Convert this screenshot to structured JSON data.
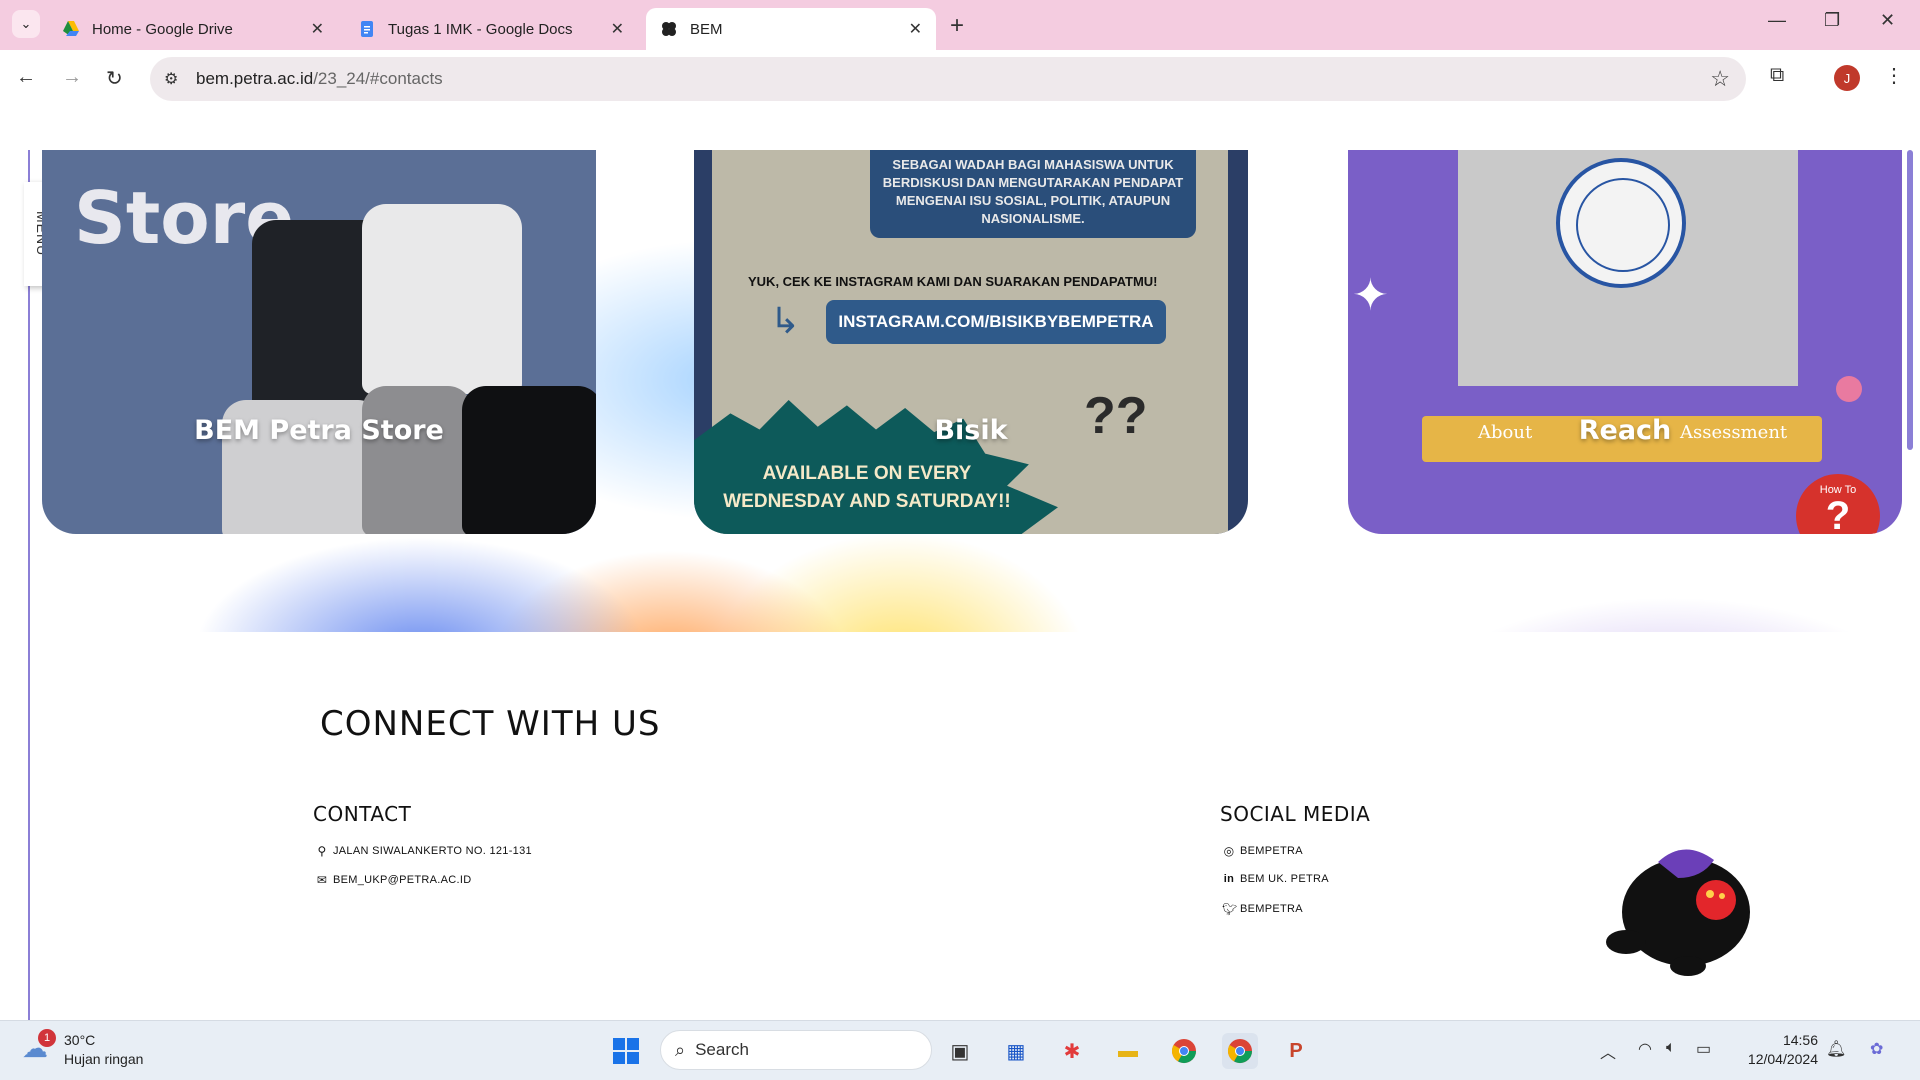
{
  "browser": {
    "tabs": [
      {
        "label": "Home - Google Drive",
        "favicon": "google-drive-icon"
      },
      {
        "label": "Tugas 1 IMK - Google Docs",
        "favicon": "google-docs-icon"
      },
      {
        "label": "BEM",
        "favicon": "bem-favicon-icon",
        "active": true
      }
    ],
    "url_host": "bem.petra.ac.id",
    "url_path": "/23_24/#contacts",
    "profile_initial": "J",
    "accent": "#f4cce0"
  },
  "page": {
    "menu_label": "MENU",
    "cards": [
      {
        "title": "BEM Petra Store",
        "image_text": "Store"
      },
      {
        "title": "Bisik",
        "image_text_box": "SEBAGAI WADAH BAGI MAHASISWA UNTUK BERDISKUSI DAN MENGUTARAKAN PENDAPAT MENGENAI ISU SOSIAL, POLITIK, ATAUPUN NASIONALISME.",
        "image_cta": "YUK, CEK KE INSTAGRAM KAMI DAN SUARAKAN PENDAPATMU!",
        "image_ig": "INSTAGRAM.COM/BISIKBYBEMPETRA",
        "image_burst": "AVAILABLE ON EVERY WEDNESDAY AND SATURDAY!!",
        "image_q": "??"
      },
      {
        "title": "Reach",
        "image_labels": [
          "About",
          "Assessment"
        ],
        "image_howto": "How To",
        "image_howto_mark": "?"
      }
    ],
    "footer": {
      "heading": "CONNECT WITH US",
      "contact": {
        "title": "CONTACT",
        "address": "JALAN SIWALANKERTO NO. 121-131",
        "email": "BEM_UKP@PETRA.AC.ID"
      },
      "social": {
        "title": "SOCIAL MEDIA",
        "instagram": "BEMPETRA",
        "linkedin": "BEM UK. PETRA",
        "twitter": "BEMPETRA"
      }
    }
  },
  "taskbar": {
    "weather_temp": "30°C",
    "weather_desc": "Hujan ringan",
    "weather_badge": "1",
    "search_placeholder": "Search",
    "time": "14:56",
    "date": "12/04/2024"
  }
}
